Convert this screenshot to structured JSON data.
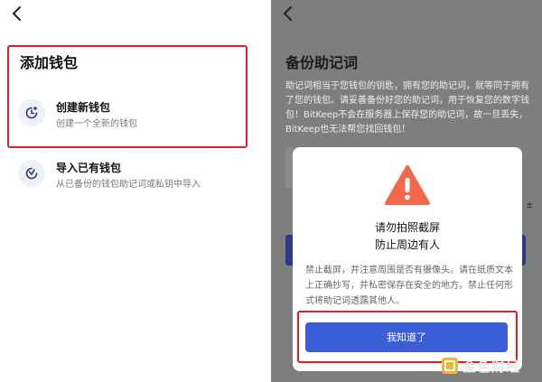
{
  "left_screen": {
    "title": "添加钱包",
    "options": [
      {
        "title": "创建新钱包",
        "subtitle": "创建一个全新的钱包",
        "icon": "clock-plus-icon"
      },
      {
        "title": "导入已有钱包",
        "subtitle": "从已备份的钱包助记词或私钥中导入",
        "icon": "import-icon"
      }
    ]
  },
  "right_screen": {
    "title": "备份助记词",
    "description": "助记词相当于您钱包的钥匙，拥有您的助记词，就等同于拥有了您的钱包。请妥善备份好您的助记词，用于恢复您的数字钱包！BitKeep不会在服务器上保存您的助记词，故一旦丢失，BitKeep也无法帮您找回钱包！",
    "modal": {
      "icon": "warning-icon",
      "heading_line1": "请勿拍照截屏",
      "heading_line2": "防止周边有人",
      "body": "禁止截屏，并注意周围是否有摄像头。请在纸质文本上正确抄写，并私密保存在安全的地方。禁止任何形式将助记词透露其他人。",
      "confirm_label": "我知道了"
    },
    "watermark": "金色财经"
  },
  "colors": {
    "highlight": "#e21d2a",
    "primary_button": "#3a5ed8",
    "warning": "#f2674a",
    "overlay": "#7e7e7e"
  }
}
